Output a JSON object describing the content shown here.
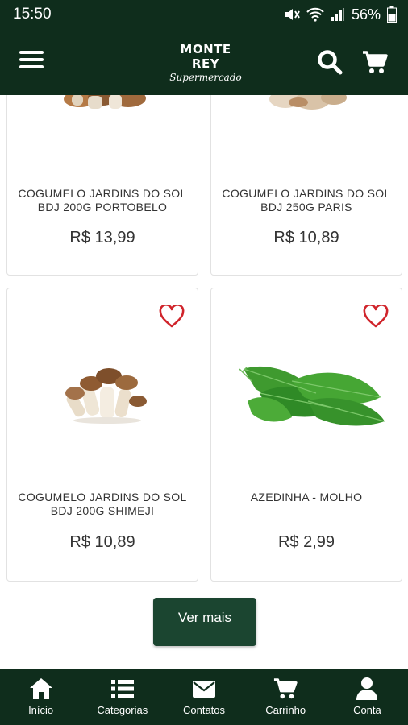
{
  "status": {
    "time": "15:50",
    "battery": "56%"
  },
  "header": {
    "logo_name": "MONTE REY",
    "logo_sub": "Supermercado"
  },
  "products": [
    {
      "name": "COGUMELO JARDINS DO SOL BDJ 200G PORTOBELO",
      "price": "R$ 13,99"
    },
    {
      "name": "COGUMELO JARDINS DO SOL BDJ 250G PARIS",
      "price": "R$ 10,89"
    },
    {
      "name": "COGUMELO JARDINS DO SOL BDJ 200G SHIMEJI",
      "price": "R$ 10,89"
    },
    {
      "name": "AZEDINHA - MOLHO",
      "price": "R$ 2,99"
    }
  ],
  "ver_mais": "Ver mais",
  "nav": [
    {
      "label": "Início",
      "icon": "home-icon"
    },
    {
      "label": "Categorias",
      "icon": "list-icon"
    },
    {
      "label": "Contatos",
      "icon": "envelope-icon"
    },
    {
      "label": "Carrinho",
      "icon": "cart-icon"
    },
    {
      "label": "Conta",
      "icon": "user-icon"
    }
  ],
  "colors": {
    "brand_dark": "#0f2d1c",
    "button": "#1b4530",
    "heart": "#d0242b"
  }
}
